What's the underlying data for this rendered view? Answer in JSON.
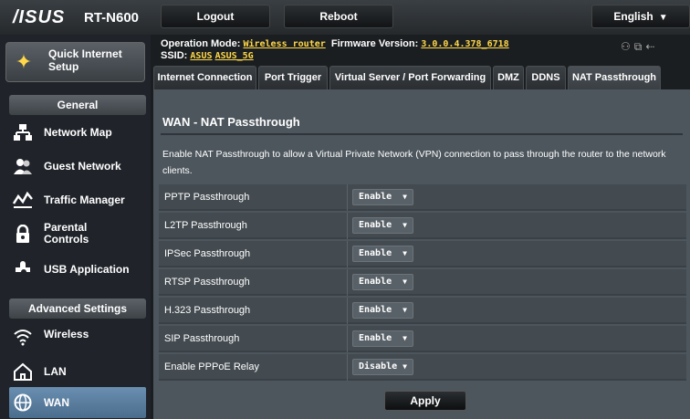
{
  "header": {
    "logo": "/ISUS",
    "model": "RT-N600",
    "logout": "Logout",
    "reboot": "Reboot",
    "language": "English"
  },
  "sidebar": {
    "quick_setup": "Quick Internet Setup",
    "general_header": "General",
    "general_items": [
      {
        "label": "Network Map",
        "icon": "network-map-icon"
      },
      {
        "label": "Guest Network",
        "icon": "guest-network-icon"
      },
      {
        "label": "Traffic Manager",
        "icon": "traffic-manager-icon"
      },
      {
        "label": "Parental Controls",
        "icon": "parental-controls-icon"
      },
      {
        "label": "USB Application",
        "icon": "usb-application-icon"
      }
    ],
    "advanced_header": "Advanced Settings",
    "advanced_items": [
      {
        "label": "Wireless",
        "icon": "wireless-icon"
      },
      {
        "label": "LAN",
        "icon": "lan-icon"
      },
      {
        "label": "WAN",
        "icon": "wan-icon",
        "active": true
      }
    ]
  },
  "status": {
    "op_mode_label": "Operation Mode:",
    "op_mode_value": "Wireless router",
    "fw_label": "Firmware Version:",
    "fw_value": "3.0.0.4.378_6718",
    "ssid_label": "SSID:",
    "ssid_1": "ASUS",
    "ssid_2": "ASUS_5G"
  },
  "tabs": [
    "Internet Connection",
    "Port Trigger",
    "Virtual Server / Port Forwarding",
    "DMZ",
    "DDNS",
    "NAT Passthrough"
  ],
  "active_tab": "NAT Passthrough",
  "main": {
    "title": "WAN - NAT Passthrough",
    "description": "Enable NAT Passthrough to allow a Virtual Private Network (VPN) connection to pass through the router to the network clients.",
    "rows": [
      {
        "label": "PPTP Passthrough",
        "value": "Enable"
      },
      {
        "label": "L2TP Passthrough",
        "value": "Enable"
      },
      {
        "label": "IPSec Passthrough",
        "value": "Enable"
      },
      {
        "label": "RTSP Passthrough",
        "value": "Enable"
      },
      {
        "label": "H.323 Passthrough",
        "value": "Enable"
      },
      {
        "label": "SIP Passthrough",
        "value": "Enable"
      },
      {
        "label": "Enable PPPoE Relay",
        "value": "Disable"
      }
    ],
    "apply": "Apply"
  },
  "colors": {
    "accent_yellow": "#ffd84a",
    "active_nav": "#5a7fa0",
    "panel_bg": "#4d565d"
  }
}
